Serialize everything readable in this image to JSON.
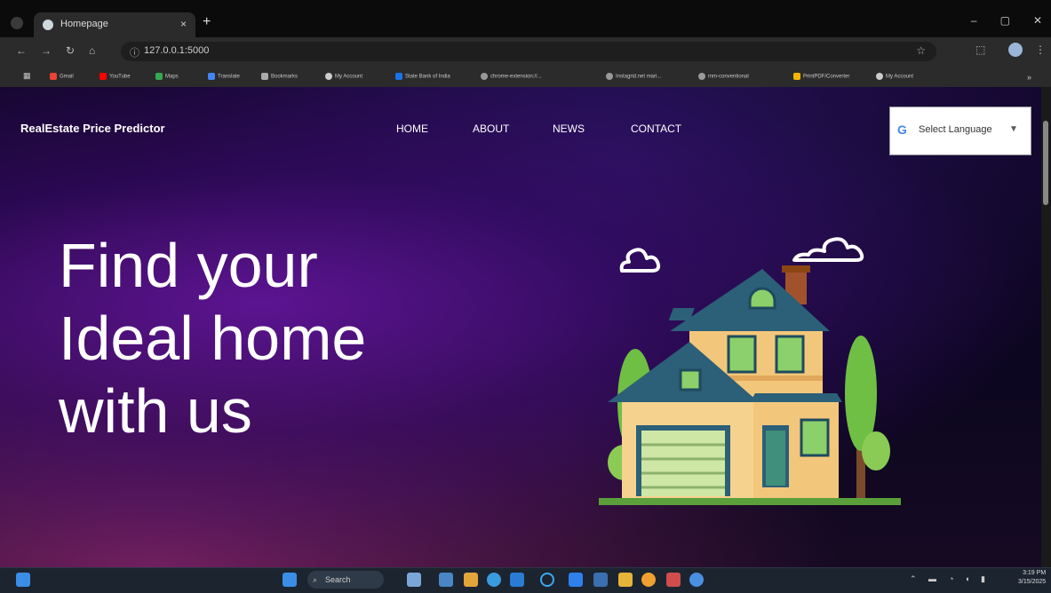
{
  "browser": {
    "tab_title": "Homepage",
    "tab_close": "×",
    "new_tab": "+",
    "url": "127.0.0.1:5000",
    "window_controls": [
      "–",
      "▢",
      "✕"
    ],
    "bookmarks": [
      {
        "label": "Gmail",
        "color": "#ea4335"
      },
      {
        "label": "YouTube",
        "color": "#ff0000"
      },
      {
        "label": "Maps",
        "color": "#34a853"
      },
      {
        "label": "Translate",
        "color": "#4285f4"
      },
      {
        "label": "Bookmarks",
        "color": "#aaaaaa"
      },
      {
        "label": "My Account",
        "color": "#cccccc"
      },
      {
        "label": "State Bank of India",
        "color": "#1a73e8"
      },
      {
        "label": "chrome-extension://...",
        "color": "#999999"
      },
      {
        "label": "Instagrid.net mari...",
        "color": "#999999"
      },
      {
        "label": "mm-conventional",
        "color": "#999999"
      },
      {
        "label": "PrintPDF/Converter",
        "color": "#f4b400"
      },
      {
        "label": "My Account",
        "color": "#cccccc"
      }
    ]
  },
  "site": {
    "brand": "RealEstate Price Predictor",
    "nav": [
      "HOME",
      "ABOUT",
      "NEWS",
      "CONTACT"
    ],
    "language_select": {
      "g": "G",
      "label": "Select Language",
      "arrow": "▼"
    },
    "hero_lines": [
      "Find your",
      "Ideal home",
      "with us"
    ]
  },
  "taskbar": {
    "search_placeholder": "Search",
    "clock_time": "3:19 PM",
    "clock_date": "3/15/2025"
  },
  "colors": {
    "accent_purple": "#4a0f8a",
    "roof": "#2c5f78",
    "wall": "#f3c77b"
  }
}
